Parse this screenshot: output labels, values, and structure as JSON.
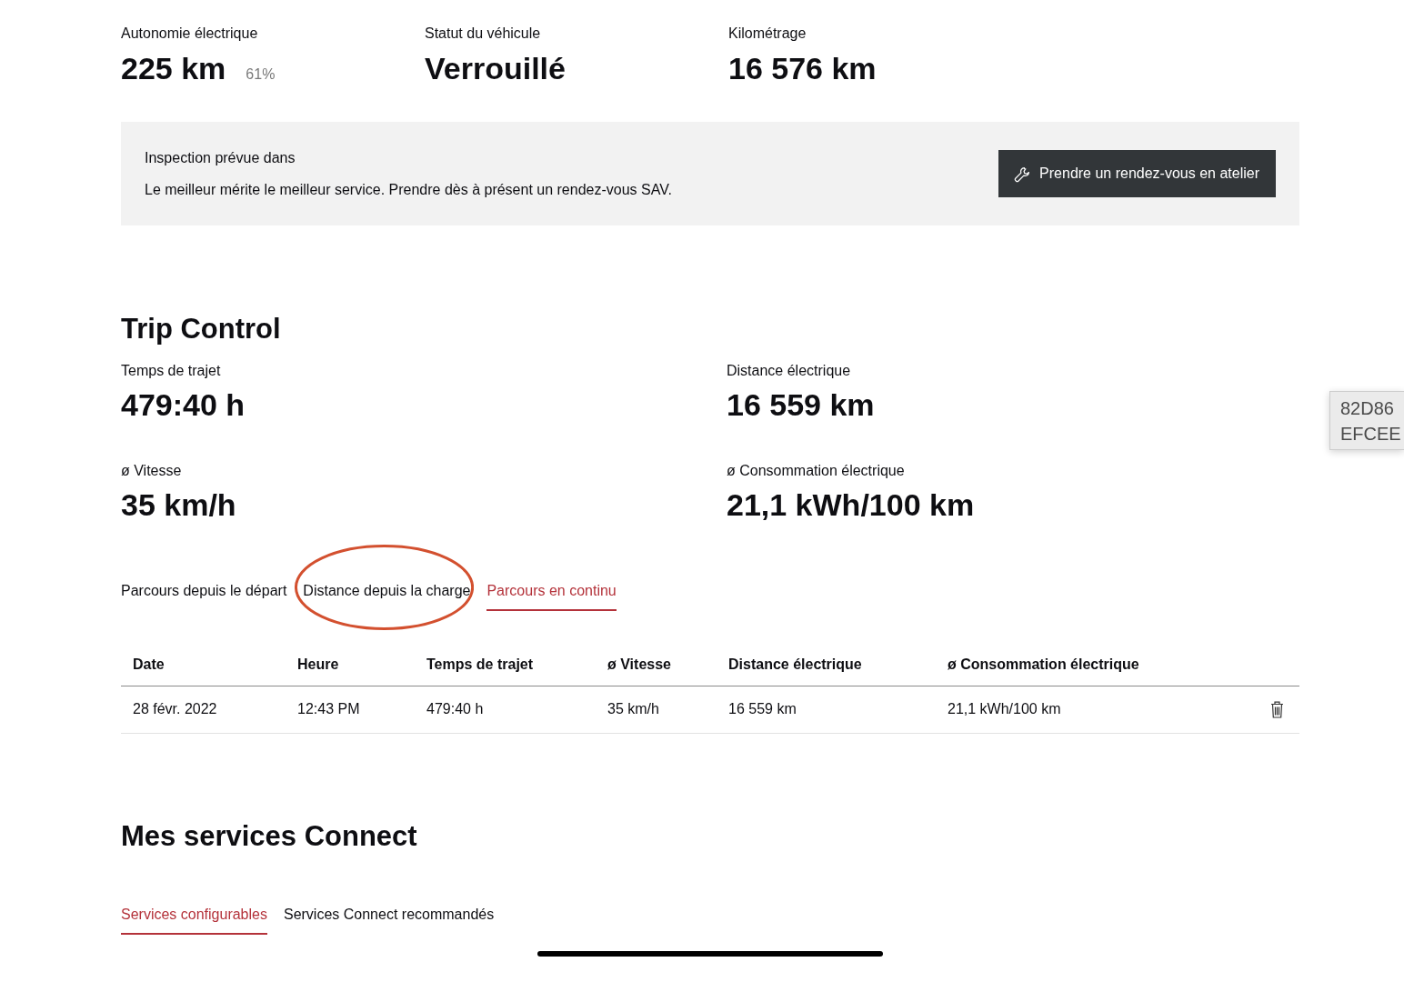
{
  "summary": [
    {
      "label": "Autonomie électrique",
      "value": "225 km",
      "note": "61%"
    },
    {
      "label": "Statut du véhicule",
      "value": "Verrouillé"
    },
    {
      "label": "Kilométrage",
      "value": "16 576 km"
    }
  ],
  "inspection": {
    "title": "Inspection prévue dans",
    "message": "Le meilleur mérite le meilleur service. Prendre dès à présent un rendez-vous SAV.",
    "button": "Prendre un rendez-vous en atelier"
  },
  "trip_control": {
    "title": "Trip Control",
    "metrics": [
      {
        "label": "Temps de trajet",
        "value": "479:40 h"
      },
      {
        "label": "Distance électrique",
        "value": "16 559 km"
      },
      {
        "label": "ø Vitesse",
        "value": "35 km/h"
      },
      {
        "label": "ø Consommation électrique",
        "value": "21,1 kWh/100 km"
      }
    ],
    "tabs": [
      {
        "label": "Parcours depuis le départ",
        "selected": false,
        "circled": false
      },
      {
        "label": "Distance depuis la charge",
        "selected": false,
        "circled": true
      },
      {
        "label": "Parcours en continu",
        "selected": true,
        "circled": false
      }
    ],
    "table": {
      "columns": [
        "Date",
        "Heure",
        "Temps de trajet",
        "ø Vitesse",
        "Distance électrique",
        "ø Consommation électrique"
      ],
      "rows": [
        {
          "cells": [
            "28 févr. 2022",
            "12:43 PM",
            "479:40 h",
            "35 km/h",
            "16 559 km",
            "21,1 kWh/100 km"
          ]
        }
      ]
    }
  },
  "connect_services": {
    "title": "Mes services Connect",
    "tabs": [
      {
        "label": "Services configurables",
        "selected": true
      },
      {
        "label": "Services Connect recommandés",
        "selected": false
      }
    ]
  },
  "floating_panel": {
    "lines": [
      "82D86",
      "EFCEE"
    ]
  }
}
